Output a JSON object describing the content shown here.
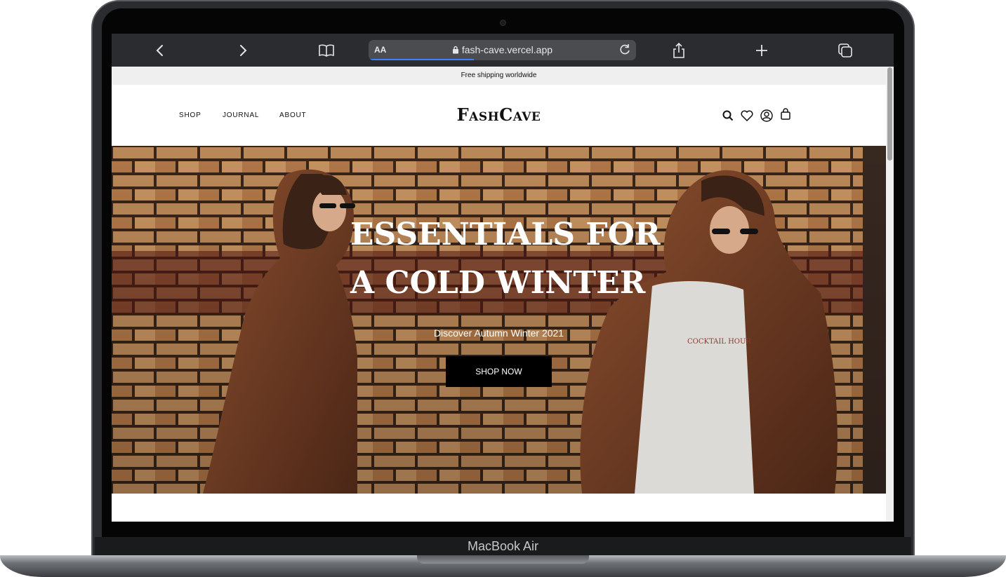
{
  "device": {
    "brand": "MacBook Air"
  },
  "browser": {
    "text_size_label": "AA",
    "url": "fash-cave.vercel.app",
    "icons": [
      "back-icon",
      "forward-icon",
      "bookmarks-icon",
      "lock-icon",
      "reload-icon",
      "share-icon",
      "new-tab-icon",
      "tabs-icon"
    ]
  },
  "announcement": {
    "text": "Free shipping worldwide"
  },
  "header": {
    "nav": [
      "SHOP",
      "JOURNAL",
      "ABOUT"
    ],
    "logo": "FashCave",
    "icons": [
      "search-icon",
      "wishlist-heart-icon",
      "account-icon",
      "cart-bag-icon"
    ]
  },
  "hero": {
    "headline_line1": "ESSENTIALS FOR",
    "headline_line2": "A COLD WINTER",
    "subtitle": "Discover Autumn Winter 2021",
    "cta_label": "SHOP NOW"
  },
  "colors": {
    "toolbar": "#2a2c2f",
    "accent_progress": "#3b82f6",
    "cta_bg": "#000000",
    "announcement_bg": "#efefef"
  }
}
